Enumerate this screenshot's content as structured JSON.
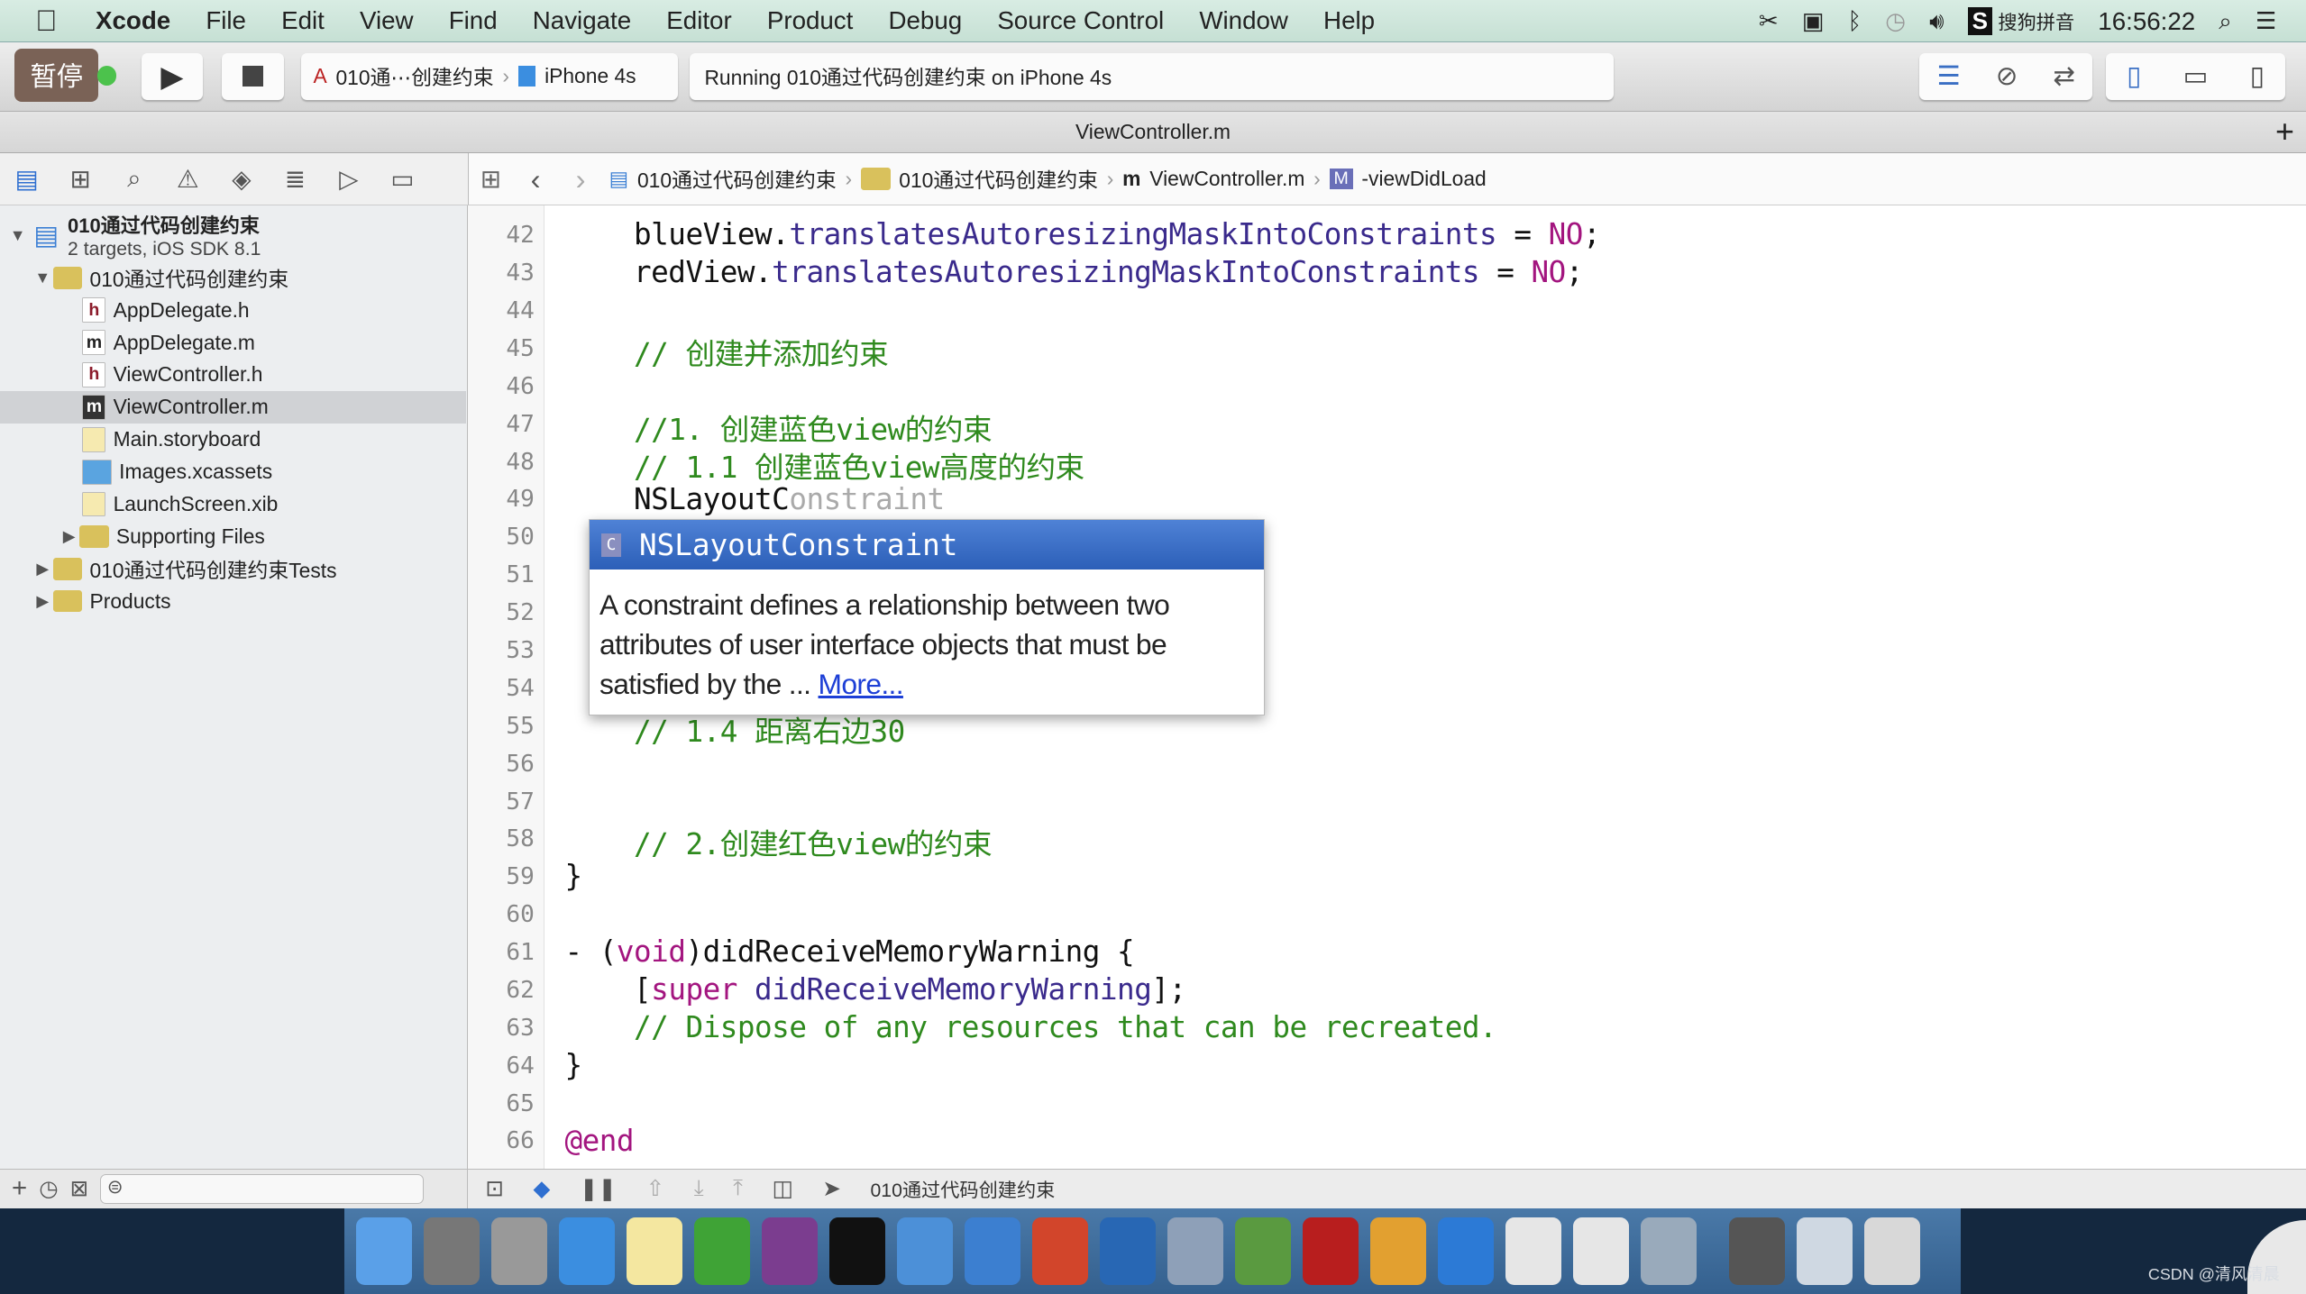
{
  "menubar": {
    "app": "Xcode",
    "items": [
      "File",
      "Edit",
      "View",
      "Find",
      "Navigate",
      "Editor",
      "Product",
      "Debug",
      "Source Control",
      "Window",
      "Help"
    ],
    "status": {
      "input_method": "搜狗拼音",
      "clock": "16:56:22",
      "icons": [
        "scissors-icon",
        "camera-icon",
        "bluetooth-icon",
        "time-machine-icon",
        "volume-icon",
        "sogou-icon",
        "search-icon",
        "list-icon"
      ]
    }
  },
  "toolbar": {
    "pause_label": "暂停",
    "scheme": "010通⋯创建约束",
    "device": "iPhone 4s",
    "activity": "Running 010通过代码创建约束 on iPhone 4s"
  },
  "tab": {
    "title": "ViewController.m"
  },
  "jumpbar": [
    "010通过代码创建约束",
    "010通过代码创建约束",
    "ViewController.m",
    "-viewDidLoad"
  ],
  "navigator": {
    "project": {
      "name": "010通过代码创建约束",
      "subtitle": "2 targets, iOS SDK 8.1"
    },
    "items": [
      {
        "label": "010通过代码创建约束",
        "type": "folder",
        "level": 1,
        "tri": "▼"
      },
      {
        "label": "AppDelegate.h",
        "type": "h",
        "level": 2
      },
      {
        "label": "AppDelegate.m",
        "type": "m",
        "level": 2
      },
      {
        "label": "ViewController.h",
        "type": "h",
        "level": 2
      },
      {
        "label": "ViewController.m",
        "type": "m",
        "level": 2,
        "selected": true
      },
      {
        "label": "Main.storyboard",
        "type": "sb",
        "level": 2
      },
      {
        "label": "Images.xcassets",
        "type": "assets",
        "level": 2
      },
      {
        "label": "LaunchScreen.xib",
        "type": "xib",
        "level": 2
      },
      {
        "label": "Supporting Files",
        "type": "folder",
        "level": 2,
        "tri": "▶"
      },
      {
        "label": "010通过代码创建约束Tests",
        "type": "folder",
        "level": 1,
        "tri": "▶"
      },
      {
        "label": "Products",
        "type": "folder",
        "level": 1,
        "tri": "▶"
      }
    ]
  },
  "code": [
    {
      "n": "42",
      "s": [
        [
          "    blueView.",
          ""
        ],
        [
          "translatesAutoresizingMaskIntoConstraints",
          "id"
        ],
        [
          " = ",
          ""
        ],
        [
          "NO",
          "kw"
        ],
        [
          ";",
          ""
        ]
      ]
    },
    {
      "n": "43",
      "s": [
        [
          "    redView.",
          ""
        ],
        [
          "translatesAutoresizingMaskIntoConstraints",
          "id"
        ],
        [
          " = ",
          ""
        ],
        [
          "NO",
          "kw"
        ],
        [
          ";",
          ""
        ]
      ]
    },
    {
      "n": "44",
      "s": []
    },
    {
      "n": "45",
      "s": [
        [
          "    // 创建并添加约束",
          "cm"
        ]
      ]
    },
    {
      "n": "46",
      "s": []
    },
    {
      "n": "47",
      "s": [
        [
          "    //1. 创建蓝色view的约束",
          "cm"
        ]
      ]
    },
    {
      "n": "48",
      "s": [
        [
          "    // 1.1 创建蓝色view高度的约束",
          "cm"
        ]
      ]
    },
    {
      "n": "49",
      "s": [
        [
          "    NSLayoutC",
          ""
        ],
        [
          "onstraint",
          "gh"
        ]
      ]
    },
    {
      "n": "50",
      "s": []
    },
    {
      "n": "51",
      "s": []
    },
    {
      "n": "52",
      "s": []
    },
    {
      "n": "53",
      "s": []
    },
    {
      "n": "54",
      "s": []
    },
    {
      "n": "55",
      "s": [
        [
          "    // 1.4 距离右边30",
          "cm"
        ]
      ]
    },
    {
      "n": "56",
      "s": []
    },
    {
      "n": "57",
      "s": []
    },
    {
      "n": "58",
      "s": [
        [
          "    // 2.创建红色view的约束",
          "cm"
        ]
      ]
    },
    {
      "n": "59",
      "s": [
        [
          "}",
          ""
        ]
      ]
    },
    {
      "n": "60",
      "s": []
    },
    {
      "n": "61",
      "s": [
        [
          "- (",
          ""
        ],
        [
          "void",
          "kw"
        ],
        [
          ")didReceiveMemoryWarning {",
          ""
        ]
      ]
    },
    {
      "n": "62",
      "s": [
        [
          "    [",
          ""
        ],
        [
          "super",
          "kw"
        ],
        [
          " ",
          ""
        ],
        [
          "didReceiveMemoryWarning",
          "id"
        ],
        [
          "];",
          ""
        ]
      ]
    },
    {
      "n": "63",
      "s": [
        [
          "    // Dispose of any resources that can be recreated.",
          "cm"
        ]
      ]
    },
    {
      "n": "64",
      "s": [
        [
          "}",
          ""
        ]
      ]
    },
    {
      "n": "65",
      "s": []
    },
    {
      "n": "66",
      "s": [
        [
          "@end",
          "kw"
        ]
      ]
    }
  ],
  "completion": {
    "title": "NSLayoutConstraint",
    "description": "A constraint defines a relationship between two attributes of user interface objects that must be satisfied by the ... ",
    "more": "More..."
  },
  "debugbar": {
    "target": "010通过代码创建约束"
  },
  "dock": [
    {
      "icon": "finder-icon",
      "color": "#5aa0e8"
    },
    {
      "icon": "system-preferences-icon",
      "color": "#777"
    },
    {
      "icon": "launchpad-icon",
      "color": "#999"
    },
    {
      "icon": "safari-icon",
      "color": "#3b8ee0"
    },
    {
      "icon": "notes-icon",
      "color": "#f4e7a0"
    },
    {
      "icon": "excel-icon",
      "color": "#3fa336"
    },
    {
      "icon": "onenote-icon",
      "color": "#7b3d8f"
    },
    {
      "icon": "terminal-icon",
      "color": "#111"
    },
    {
      "icon": "xcode-icon",
      "color": "#4c90d8"
    },
    {
      "icon": "simulator-icon",
      "color": "#3c7fd0"
    },
    {
      "icon": "powerpoint-icon",
      "color": "#d2452b"
    },
    {
      "icon": "snip-icon",
      "color": "#2867b4"
    },
    {
      "icon": "movie-icon",
      "color": "#8ea0b8"
    },
    {
      "icon": "ftp-icon",
      "color": "#5a9a40"
    },
    {
      "icon": "filezilla-icon",
      "color": "#b81e1e"
    },
    {
      "icon": "pencil-app-icon",
      "color": "#e2a030"
    },
    {
      "icon": "word-icon",
      "color": "#2c7ad6"
    },
    {
      "icon": "document-icon",
      "color": "#e6e6e6"
    },
    {
      "icon": "document-icon",
      "color": "#e6e6e6"
    },
    {
      "icon": "preview-icon",
      "color": "#9ab"
    },
    {
      "icon": "screen-icon",
      "color": "#555"
    },
    {
      "icon": "folder-icon",
      "color": "#cfd8e2"
    },
    {
      "icon": "trash-icon",
      "color": "#d8d8d8"
    }
  ],
  "watermark": "CSDN @清风清晨",
  "colors": {
    "comment": "#2f8a1e",
    "keyword": "#a3157f",
    "identifier": "#3a2a8c",
    "selection": "#2c5fb8"
  }
}
